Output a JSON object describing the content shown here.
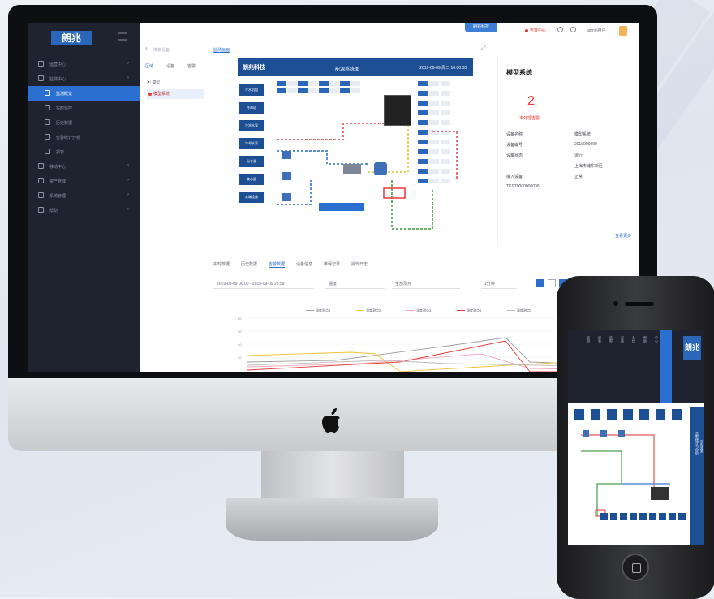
{
  "brand": {
    "logo_text": "朗兆",
    "primary": "#2b6fd0",
    "dark": "#1f2330",
    "alarm": "#e53935"
  },
  "sidebar": {
    "items": [
      {
        "label": "运营中心",
        "icon": "home-icon"
      },
      {
        "label": "监测中心",
        "icon": "monitor-icon"
      },
      {
        "label": "监测概览",
        "icon": "dashboard-icon",
        "active": true
      },
      {
        "label": "实时监控",
        "icon": "chart-icon"
      },
      {
        "label": "历史数据",
        "icon": "history-icon"
      },
      {
        "label": "告警统计分析",
        "icon": "analysis-icon"
      },
      {
        "label": "报表",
        "icon": "report-icon"
      },
      {
        "label": "移动中心",
        "icon": "mobile-icon"
      },
      {
        "label": "资产管理",
        "icon": "asset-icon"
      },
      {
        "label": "系统管理",
        "icon": "settings-icon"
      },
      {
        "label": "帮助",
        "icon": "help-icon"
      }
    ]
  },
  "topbar": {
    "badge": "朗兆科技",
    "alarm_text": "告警中心",
    "user_text": "admin用户"
  },
  "tree": {
    "search_placeholder": "搜索设备",
    "tabs": [
      "区域",
      "设备",
      "告警"
    ],
    "node": "模型",
    "leaf": "模型系统"
  },
  "main": {
    "breadcrumb": "监测画面",
    "diagram": {
      "brand": "朗兆科技",
      "title": "能源系统图",
      "datetime": "2019-09-09 周二 10:00:00",
      "buttons": [
        "冷水机组",
        "冷却塔",
        "冷冻水泵",
        "冷却水泵",
        "分水器",
        "集水器",
        "末端设备"
      ]
    },
    "info": {
      "title": "模型系统",
      "count": "2",
      "count_label": "未处理告警",
      "rows": [
        {
          "k": "设备名称",
          "v": "模型系统"
        },
        {
          "k": "设备编号",
          "v": "2019000000"
        },
        {
          "k": "设备状态",
          "v": "运行"
        },
        {
          "k": "",
          "v": "上海市浦东新区"
        },
        {
          "k": "接入设备",
          "v": "正常"
        },
        {
          "k": "TEST0000000000",
          "v": ""
        }
      ],
      "more": "查看更多"
    },
    "content_tabs": [
      "实时数据",
      "历史数据",
      "告警数据",
      "设备信息",
      "维保记录",
      "操作日志"
    ],
    "active_tab": 2,
    "filters": {
      "range": "2019-09-09 00:00 - 2019-09-09 23:59",
      "type": "温度",
      "point": "全部测点",
      "interval": "1分钟"
    },
    "legend": [
      "温度测点1",
      "温度测点2",
      "温度测点3",
      "温度测点4",
      "温度测点5"
    ],
    "y_ticks": [
      "60",
      "50",
      "40",
      "30"
    ]
  },
  "phone": {
    "logo_text": "朗兆",
    "menu": [
      "监测",
      "报表",
      "告警",
      "设备",
      "系统",
      "帮助",
      "中心"
    ],
    "side_labels": [
      "实时监测",
      "告警统计与分析"
    ]
  },
  "chart_data": {
    "type": "line",
    "series": [
      {
        "name": "温度测点1",
        "color": "#9e9e9e"
      },
      {
        "name": "温度测点2",
        "color": "#f2c230"
      },
      {
        "name": "温度测点3",
        "color": "#f7a8b8"
      },
      {
        "name": "温度测点4",
        "color": "#e53935"
      },
      {
        "name": "温度测点5",
        "color": "#bdbdbd"
      }
    ]
  }
}
